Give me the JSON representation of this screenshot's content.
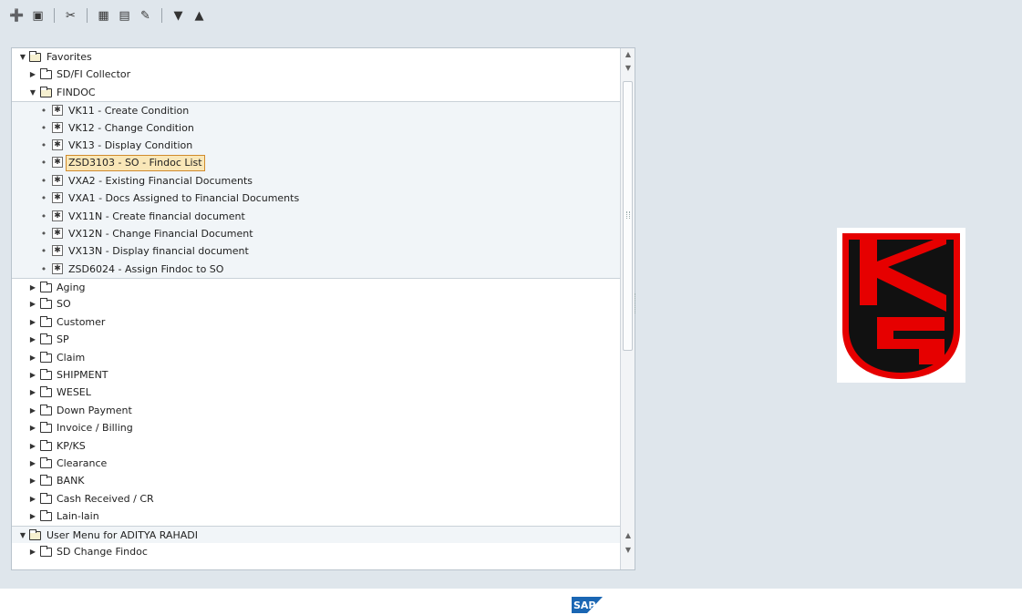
{
  "colors": {
    "window_bg": "#dfe6ec",
    "panel_bg": "#ffffff",
    "group_bg": "#f1f5f8",
    "selection_bg": "#f9e7b8",
    "selection_border": "#d08a2c",
    "logo_red": "#e60000",
    "sap_blue": "#1a66b3"
  },
  "toolbar": {
    "icons": [
      "add-favorite-icon",
      "edit-favorite-icon",
      "delete-favorite-icon",
      "other-object-icon",
      "change-icon",
      "pencil-icon",
      "move-down-icon",
      "move-up-icon"
    ]
  },
  "tree": {
    "favorites": {
      "label": "Favorites",
      "items": [
        {
          "label": "SD/FI Collector"
        },
        {
          "label": "FINDOC",
          "children": [
            "VK11 - Create Condition",
            "VK12 - Change Condition",
            "VK13 - Display Condition",
            "ZSD3103 - SO - Findoc List",
            "VXA2 - Existing Financial Documents",
            "VXA1 - Docs Assigned to Financial Documents",
            "VX11N - Create financial document",
            "VX12N - Change Financial Document",
            "VX13N - Display financial document",
            "ZSD6024 - Assign Findoc to SO"
          ]
        },
        {
          "label": "Aging"
        },
        {
          "label": "SO"
        },
        {
          "label": "Customer"
        },
        {
          "label": "SP"
        },
        {
          "label": "Claim"
        },
        {
          "label": "SHIPMENT"
        },
        {
          "label": "WESEL"
        },
        {
          "label": "Down Payment"
        },
        {
          "label": "Invoice / Billing"
        },
        {
          "label": "KP/KS"
        },
        {
          "label": "Clearance"
        },
        {
          "label": "BANK"
        },
        {
          "label": "Cash Received / CR"
        },
        {
          "label": "Lain-lain"
        }
      ]
    },
    "user_menu": {
      "label": "User Menu for ADITYA RAHADI",
      "items": [
        {
          "label": "SD Change Findoc"
        }
      ]
    }
  },
  "status": {
    "logo_text": "SAP"
  }
}
